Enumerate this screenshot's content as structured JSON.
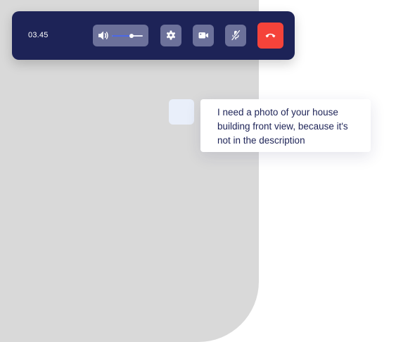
{
  "call": {
    "timer": "03.45",
    "volume_level": 0.64,
    "controls": {
      "speaker_icon": "speaker-icon",
      "settings_icon": "gear-icon",
      "video_icon": "video-camera-icon",
      "mic_icon": "microphone-muted-icon",
      "end_call_icon": "phone-hangup-icon"
    },
    "colors": {
      "bar": "#1d2357",
      "button": "#6c719a",
      "end_call": "#f5433a",
      "volume_fill": "#4c69e6"
    }
  },
  "chat": {
    "message": "I need a photo of your house building front view, because it's not in the description"
  }
}
